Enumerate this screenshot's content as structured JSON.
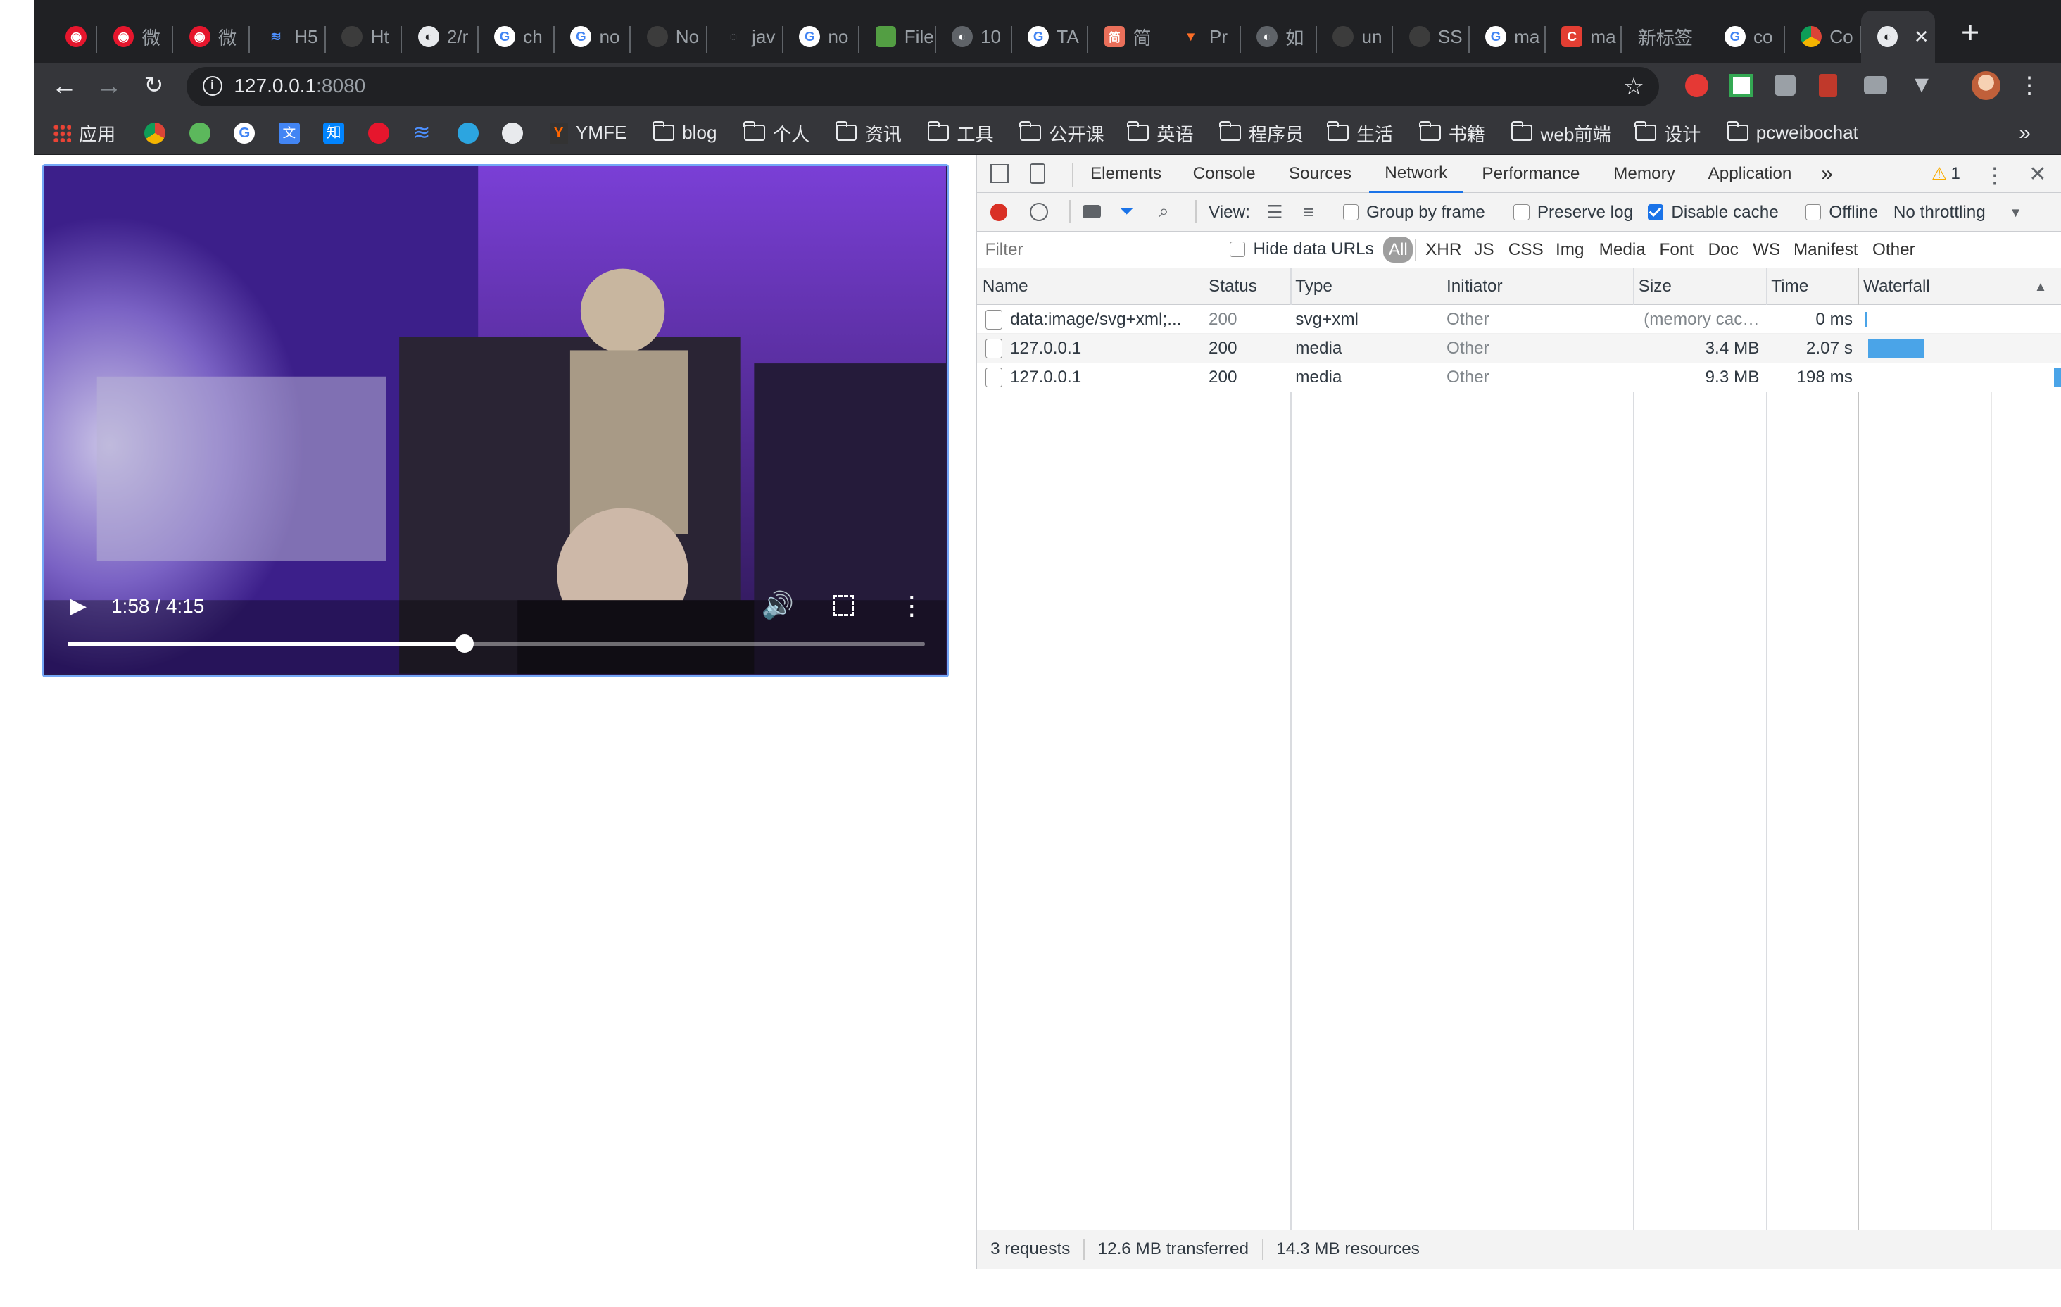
{
  "tabs": [
    {
      "label": "",
      "icon": "weibo-icon"
    },
    {
      "label": "微",
      "icon": "weibo-icon"
    },
    {
      "label": "微",
      "icon": "weibo-icon"
    },
    {
      "label": "H5",
      "icon": "layers-icon"
    },
    {
      "label": "Ht",
      "icon": "github-icon"
    },
    {
      "label": "2/r",
      "icon": "globe-icon"
    },
    {
      "label": "ch",
      "icon": "google-icon"
    },
    {
      "label": "no",
      "icon": "google-icon"
    },
    {
      "label": "No",
      "icon": "github-icon"
    },
    {
      "label": "jav",
      "icon": "loading-icon"
    },
    {
      "label": "no",
      "icon": "google-icon"
    },
    {
      "label": "File",
      "icon": "node-icon"
    },
    {
      "label": "10",
      "icon": "globe-icon"
    },
    {
      "label": "TA",
      "icon": "google-icon"
    },
    {
      "label": "简",
      "icon": "jianshu-icon"
    },
    {
      "label": "Pr",
      "icon": "gitlab-icon"
    },
    {
      "label": "如",
      "icon": "globe-icon"
    },
    {
      "label": "un",
      "icon": "github-icon"
    },
    {
      "label": "SS",
      "icon": "github-icon"
    },
    {
      "label": "ma",
      "icon": "google-icon"
    },
    {
      "label": "ma",
      "icon": "csdn-icon"
    },
    {
      "label": "新标签",
      "icon": ""
    },
    {
      "label": "co",
      "icon": "google-icon"
    },
    {
      "label": "Co",
      "icon": "chrome-icon"
    },
    {
      "label": "",
      "icon": "globe-icon"
    }
  ],
  "address": {
    "host": "127.0.0.1",
    "port": ":8080"
  },
  "bookmarks": {
    "apps": "应用",
    "ymfe": "YMFE",
    "folders": [
      "blog",
      "个人",
      "资讯",
      "工具",
      "公开课",
      "英语",
      "程序员",
      "生活",
      "书籍",
      "web前端",
      "设计",
      "pcweibochat"
    ],
    "more": "»"
  },
  "video": {
    "current": "1:58",
    "separator": "/",
    "duration": "4:15",
    "progress": 0.4627
  },
  "devtools": {
    "tabs": [
      "Elements",
      "Console",
      "Sources",
      "Network",
      "Performance",
      "Memory",
      "Application"
    ],
    "warnings": "1",
    "toolbar": {
      "view": "View:",
      "group_by_frame": "Group by frame",
      "preserve_log": "Preserve log",
      "disable_cache": "Disable cache",
      "offline": "Offline",
      "throttling": "No throttling"
    },
    "filter": {
      "placeholder": "Filter",
      "hide_data_urls": "Hide data URLs",
      "types": [
        "All",
        "XHR",
        "JS",
        "CSS",
        "Img",
        "Media",
        "Font",
        "Doc",
        "WS",
        "Manifest",
        "Other"
      ]
    },
    "columns": [
      "Name",
      "Status",
      "Type",
      "Initiator",
      "Size",
      "Time",
      "Waterfall"
    ],
    "rows": [
      {
        "name": "data:image/svg+xml;...",
        "status": "200",
        "type": "svg+xml",
        "initiator": "Other",
        "size": "(memory cac…",
        "time": "0 ms"
      },
      {
        "name": "127.0.0.1",
        "status": "200",
        "type": "media",
        "initiator": "Other",
        "size": "3.4 MB",
        "time": "2.07 s"
      },
      {
        "name": "127.0.0.1",
        "status": "200",
        "type": "media",
        "initiator": "Other",
        "size": "9.3 MB",
        "time": "198 ms"
      }
    ],
    "summary": {
      "requests": "3 requests",
      "transferred": "12.6 MB transferred",
      "resources": "14.3 MB resources"
    }
  },
  "colors": {
    "accent": "#1a73e8",
    "waterfall": "#4aa4e8",
    "record": "#d93025",
    "tabbar": "#202124",
    "toolbar": "#35363a"
  }
}
